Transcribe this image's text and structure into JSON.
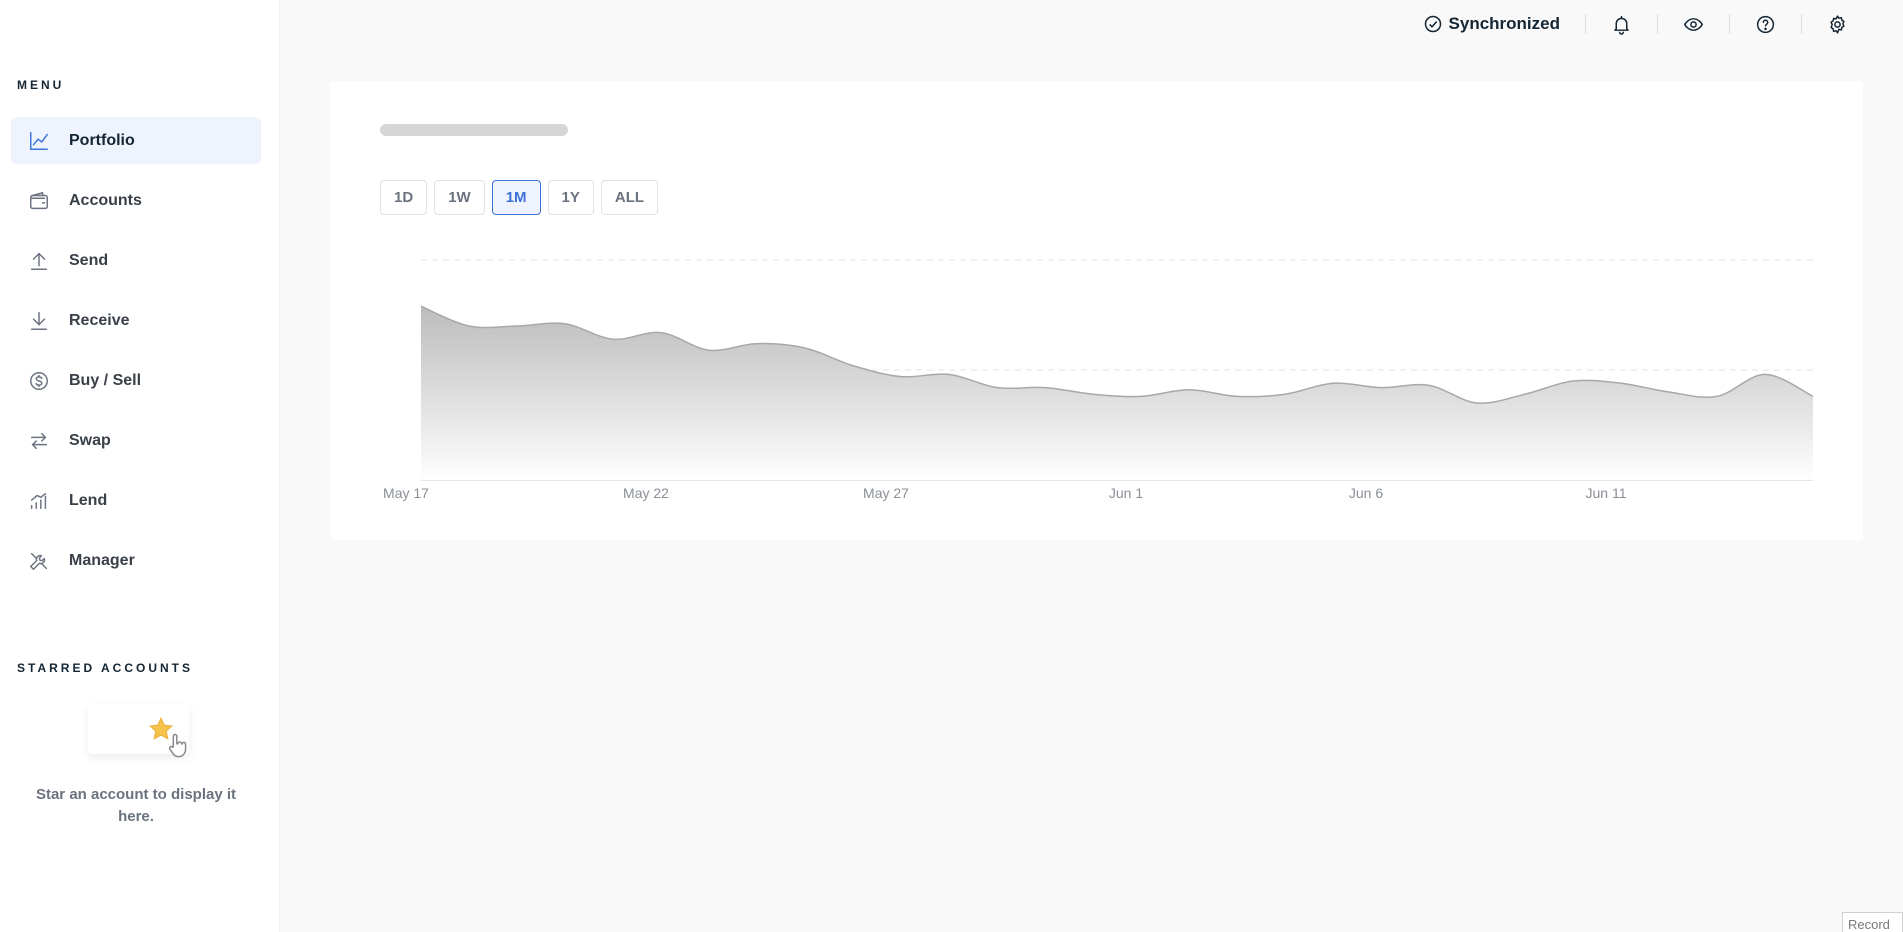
{
  "sidebar": {
    "menu_heading": "MENU",
    "items": [
      {
        "label": "Portfolio",
        "icon": "chart-line-icon",
        "active": true
      },
      {
        "label": "Accounts",
        "icon": "wallet-icon"
      },
      {
        "label": "Send",
        "icon": "arrow-up-icon"
      },
      {
        "label": "Receive",
        "icon": "arrow-down-icon"
      },
      {
        "label": "Buy / Sell",
        "icon": "dollar-circle-icon"
      },
      {
        "label": "Swap",
        "icon": "swap-arrows-icon"
      },
      {
        "label": "Lend",
        "icon": "signal-bars-icon"
      },
      {
        "label": "Manager",
        "icon": "tools-icon"
      }
    ],
    "starred_heading": "STARRED ACCOUNTS",
    "starred_empty_text": "Star an account to display it here."
  },
  "topbar": {
    "sync_status": "Synchronized",
    "buttons": [
      "bell-icon",
      "eye-icon",
      "help-circle-icon",
      "gear-icon"
    ]
  },
  "portfolio": {
    "ranges": [
      "1D",
      "1W",
      "1M",
      "1Y",
      "ALL"
    ],
    "selected_range": "1M"
  },
  "colors": {
    "accent": "#3b73d9",
    "accent_bg": "#eef3fd",
    "chart_fill": "#b9b9b9",
    "star": "#f5c24b"
  },
  "chart_data": {
    "type": "area",
    "x": [
      "May 17",
      "May 18",
      "May 19",
      "May 20",
      "May 21",
      "May 22",
      "May 23",
      "May 24",
      "May 25",
      "May 26",
      "May 27",
      "May 28",
      "May 29",
      "May 30",
      "May 31",
      "Jun 1",
      "Jun 2",
      "Jun 3",
      "Jun 4",
      "Jun 5",
      "Jun 6",
      "Jun 7",
      "Jun 8",
      "Jun 9",
      "Jun 10",
      "Jun 11",
      "Jun 12",
      "Jun 13",
      "Jun 14",
      "Jun 15"
    ],
    "values": [
      0.79,
      0.7,
      0.7,
      0.71,
      0.64,
      0.67,
      0.59,
      0.62,
      0.6,
      0.52,
      0.47,
      0.48,
      0.42,
      0.42,
      0.39,
      0.38,
      0.41,
      0.38,
      0.39,
      0.44,
      0.42,
      0.43,
      0.35,
      0.39,
      0.45,
      0.44,
      0.4,
      0.38,
      0.48,
      0.38
    ],
    "xticks": [
      "May 17",
      "May 22",
      "May 27",
      "Jun 1",
      "Jun 6",
      "Jun 11"
    ],
    "ylim": [
      0,
      1
    ],
    "grid": true,
    "title": "",
    "xlabel": "",
    "ylabel": ""
  },
  "footer": {
    "badge": "Record"
  }
}
